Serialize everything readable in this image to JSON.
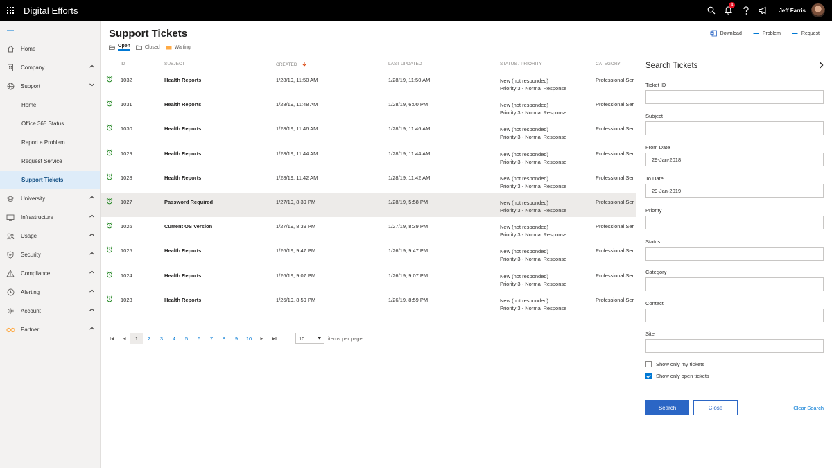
{
  "app": {
    "title": "Digital Efforts"
  },
  "topbar": {
    "notification_count": "4",
    "user_name": "Jeff Farris"
  },
  "sidebar": {
    "items": [
      {
        "label": "Home",
        "icon": "home-icon",
        "chevron": ""
      },
      {
        "label": "Company",
        "icon": "building-icon",
        "chevron": "up"
      },
      {
        "label": "Support",
        "icon": "globe-icon",
        "chevron": "down"
      },
      {
        "label": "Home",
        "sub": true
      },
      {
        "label": "Office 365 Status",
        "sub": true
      },
      {
        "label": "Report a Problem",
        "sub": true
      },
      {
        "label": "Request Service",
        "sub": true
      },
      {
        "label": "Support Tickets",
        "sub": true,
        "active": true
      },
      {
        "label": "University",
        "icon": "graduation-cap-icon",
        "chevron": "up"
      },
      {
        "label": "Infrastructure",
        "icon": "monitor-icon",
        "chevron": "up"
      },
      {
        "label": "Usage",
        "icon": "people-icon",
        "chevron": "up"
      },
      {
        "label": "Security",
        "icon": "shield-icon",
        "chevron": "up"
      },
      {
        "label": "Compliance",
        "icon": "warning-icon",
        "chevron": "up"
      },
      {
        "label": "Alerting",
        "icon": "clock-icon",
        "chevron": "up"
      },
      {
        "label": "Account",
        "icon": "gear-icon",
        "chevron": "up"
      },
      {
        "label": "Partner",
        "icon": "partner-icon",
        "chevron": "up"
      }
    ]
  },
  "page": {
    "title": "Support Tickets",
    "tabs": [
      {
        "label": "Open",
        "active": true
      },
      {
        "label": "Closed"
      },
      {
        "label": "Waiting"
      }
    ],
    "actions": {
      "download": "Download",
      "problem": "Problem",
      "request": "Request"
    }
  },
  "table": {
    "columns": {
      "id": "ID",
      "subject": "Subject",
      "created": "Created",
      "updated": "Last Updated",
      "status": "Status / Priority",
      "category": "Category"
    },
    "rows": [
      {
        "id": "1032",
        "subject": "Health Reports",
        "created": "1/28/19, 11:50 AM",
        "updated": "1/28/19, 11:50 AM",
        "status": "New (not responded)",
        "priority": "Priority 3 - Normal Response",
        "category": "Professional Ser"
      },
      {
        "id": "1031",
        "subject": "Health Reports",
        "created": "1/28/19, 11:48 AM",
        "updated": "1/28/19, 6:00 PM",
        "status": "New (not responded)",
        "priority": "Priority 3 - Normal Response",
        "category": "Professional Ser"
      },
      {
        "id": "1030",
        "subject": "Health Reports",
        "created": "1/28/19, 11:46 AM",
        "updated": "1/28/19, 11:46 AM",
        "status": "New (not responded)",
        "priority": "Priority 3 - Normal Response",
        "category": "Professional Ser"
      },
      {
        "id": "1029",
        "subject": "Health Reports",
        "created": "1/28/19, 11:44 AM",
        "updated": "1/28/19, 11:44 AM",
        "status": "New (not responded)",
        "priority": "Priority 3 - Normal Response",
        "category": "Professional Ser"
      },
      {
        "id": "1028",
        "subject": "Health Reports",
        "created": "1/28/19, 11:42 AM",
        "updated": "1/28/19, 11:42 AM",
        "status": "New (not responded)",
        "priority": "Priority 3 - Normal Response",
        "category": "Professional Ser"
      },
      {
        "id": "1027",
        "subject": "Password Required",
        "created": "1/27/19, 8:39 PM",
        "updated": "1/28/19, 5:58 PM",
        "status": "New (not responded)",
        "priority": "Priority 3 - Normal Response",
        "category": "Professional Ser",
        "highlight": true
      },
      {
        "id": "1026",
        "subject": "Current OS Version",
        "created": "1/27/19, 8:39 PM",
        "updated": "1/27/19, 8:39 PM",
        "status": "New (not responded)",
        "priority": "Priority 3 - Normal Response",
        "category": "Professional Ser"
      },
      {
        "id": "1025",
        "subject": "Health Reports",
        "created": "1/26/19, 9:47 PM",
        "updated": "1/26/19, 9:47 PM",
        "status": "New (not responded)",
        "priority": "Priority 3 - Normal Response",
        "category": "Professional Ser"
      },
      {
        "id": "1024",
        "subject": "Health Reports",
        "created": "1/26/19, 9:07 PM",
        "updated": "1/26/19, 9:07 PM",
        "status": "New (not responded)",
        "priority": "Priority 3 - Normal Response",
        "category": "Professional Ser"
      },
      {
        "id": "1023",
        "subject": "Health Reports",
        "created": "1/26/19, 8:59 PM",
        "updated": "1/26/19, 8:59 PM",
        "status": "New (not responded)",
        "priority": "Priority 3 - Normal Response",
        "category": "Professional Ser"
      }
    ]
  },
  "pager": {
    "pages": [
      "1",
      "2",
      "3",
      "4",
      "5",
      "6",
      "7",
      "8",
      "9",
      "10"
    ],
    "current": "1",
    "per_page": "10",
    "per_page_label": "items per page"
  },
  "search_panel": {
    "title": "Search Tickets",
    "fields": [
      {
        "label": "Ticket ID",
        "value": ""
      },
      {
        "label": "Subject",
        "value": ""
      },
      {
        "label": "From Date",
        "value": "29-Jan-2018"
      },
      {
        "label": "To Date",
        "value": "29-Jan-2019"
      },
      {
        "label": "Priority",
        "value": ""
      },
      {
        "label": "Status",
        "value": ""
      },
      {
        "label": "Category",
        "value": ""
      },
      {
        "label": "Contact",
        "value": ""
      },
      {
        "label": "Site",
        "value": ""
      }
    ],
    "checks": [
      {
        "label": "Show only my tickets",
        "checked": false
      },
      {
        "label": "Show only open tickets",
        "checked": true
      }
    ],
    "search_button": "Search",
    "close_button": "Close",
    "clear_link": "Clear Search"
  },
  "colors": {
    "accent": "#0078d4",
    "primary_button": "#2b66c5",
    "alarm_green": "#107c10",
    "folder_orange": "#ffaa44",
    "notification": "#e81123"
  }
}
